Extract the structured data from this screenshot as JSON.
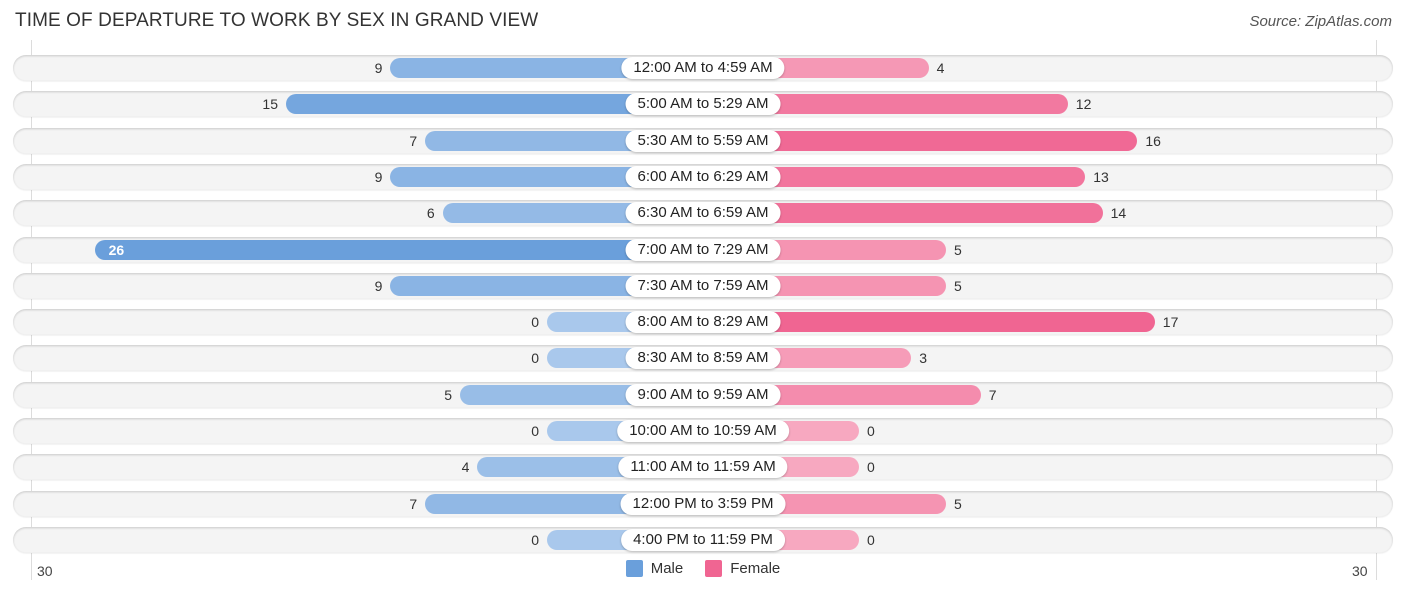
{
  "header": {
    "title": "TIME OF DEPARTURE TO WORK BY SEX IN GRAND VIEW",
    "source": "Source: ZipAtlas.com"
  },
  "colors": {
    "male": "#6a9fdb",
    "male_light": "#a9c8ec",
    "female": "#f06592",
    "female_light": "#f7a8c0"
  },
  "chart_data": {
    "type": "bar",
    "orientation": "horizontal-diverging",
    "title": "TIME OF DEPARTURE TO WORK BY SEX IN GRAND VIEW",
    "categories": [
      "12:00 AM to 4:59 AM",
      "5:00 AM to 5:29 AM",
      "5:30 AM to 5:59 AM",
      "6:00 AM to 6:29 AM",
      "6:30 AM to 6:59 AM",
      "7:00 AM to 7:29 AM",
      "7:30 AM to 7:59 AM",
      "8:00 AM to 8:29 AM",
      "8:30 AM to 8:59 AM",
      "9:00 AM to 9:59 AM",
      "10:00 AM to 10:59 AM",
      "11:00 AM to 11:59 AM",
      "12:00 PM to 3:59 PM",
      "4:00 PM to 11:59 PM"
    ],
    "series": [
      {
        "name": "Male",
        "values": [
          9,
          15,
          7,
          9,
          6,
          26,
          9,
          0,
          0,
          5,
          0,
          4,
          7,
          0
        ]
      },
      {
        "name": "Female",
        "values": [
          4,
          12,
          16,
          13,
          14,
          5,
          5,
          17,
          3,
          7,
          0,
          0,
          5,
          0
        ]
      }
    ],
    "xlim": [
      -30,
      30
    ],
    "tick_labels": {
      "left": "30",
      "right": "30"
    },
    "legend": {
      "entries": [
        "Male",
        "Female"
      ],
      "position": "bottom-center"
    }
  }
}
